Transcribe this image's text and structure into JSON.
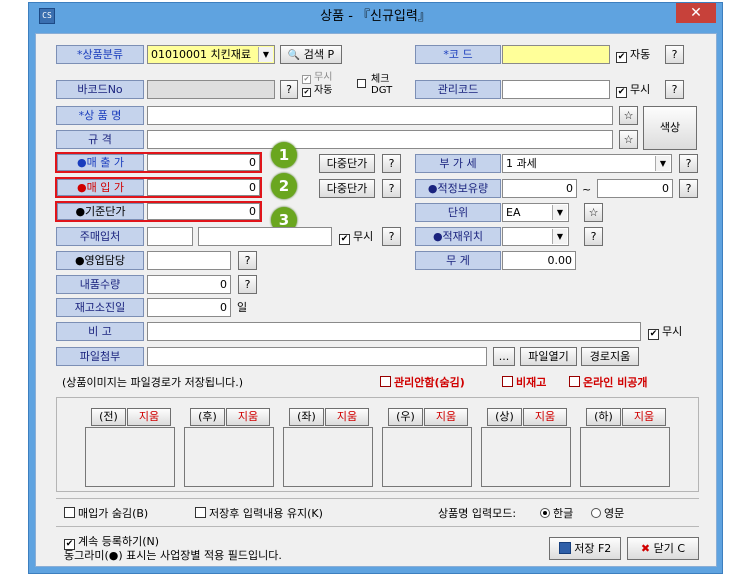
{
  "window": {
    "title": "상품 - 『신규입력』",
    "app_icon_text": "CS",
    "close": "✕"
  },
  "fields": {
    "product_category": {
      "label": "*상품분류",
      "value": "01010001 치킨재료",
      "search": "검색 P"
    },
    "code": {
      "label": "*코     드",
      "value": "",
      "auto_label": "자동",
      "help": "?"
    },
    "barcode": {
      "label": "바코드No",
      "value": "",
      "help": "?",
      "ignore": "무시",
      "auto": "자동",
      "check_dgt": "체크\nDGT"
    },
    "mgmt_code": {
      "label": "관리코드",
      "value": "",
      "ignore": "무시",
      "help": "?"
    },
    "product_name": {
      "label": "*상 품 명",
      "value": "",
      "star": "☆"
    },
    "spec": {
      "label": "규     격",
      "value": "",
      "star": "☆"
    },
    "color_size": "색상",
    "sale_price": {
      "label": "●매 출 가",
      "value": "0",
      "multi": "다중단가",
      "help": "?"
    },
    "purchase_price": {
      "label": "●매 입 가",
      "value": "0",
      "multi": "다중단가",
      "help": "?"
    },
    "base_price": {
      "label": "●기준단가",
      "value": "0"
    },
    "vat": {
      "label": "부 가 세",
      "value": "1 과세",
      "help": "?"
    },
    "safety_stock": {
      "label": "●적정보유량",
      "value_from": "0",
      "tilde": "~",
      "value_to": "0",
      "help": "?"
    },
    "unit": {
      "label": "단위",
      "value": "EA",
      "star": "☆"
    },
    "main_supplier": {
      "label": "주매입처",
      "ignore": "무시",
      "help": "?"
    },
    "location": {
      "label": "●적재위치",
      "value": "",
      "help": "?"
    },
    "sales_rep": {
      "label": "●영업담당",
      "value": "",
      "help": "?"
    },
    "weight": {
      "label": "무     게",
      "value": "0.00"
    },
    "delivery_qty": {
      "label": "내품수량",
      "value": "0",
      "help": "?"
    },
    "stock_days": {
      "label": "재고소진일",
      "value": "0",
      "unit": "일"
    },
    "remark": {
      "label": "비     고",
      "value": "",
      "ignore": "무시"
    },
    "attachment": {
      "label": "파일첨부",
      "value": "",
      "browse": "...",
      "open": "파일열기",
      "clear_path": "경로지움"
    }
  },
  "image_note": "(상품이미지는 파일경로가 저장됩니다.)",
  "flags": [
    "관리안함(숨김)",
    "비재고",
    "온라인 비공개"
  ],
  "image_panels": [
    {
      "label": "(전)",
      "delete": "지움"
    },
    {
      "label": "(후)",
      "delete": "지움"
    },
    {
      "label": "(좌)",
      "delete": "지움"
    },
    {
      "label": "(우)",
      "delete": "지움"
    },
    {
      "label": "(상)",
      "delete": "지움"
    },
    {
      "label": "(하)",
      "delete": "지움"
    }
  ],
  "options": {
    "hide_purchase": "매입가 숨김(B)",
    "keep_after_save": "저장후 입력내용 유지(K)",
    "name_input_mode": "상품명 입력모드:",
    "korean": "한글",
    "english": "영문",
    "continuous": "계속 등록하기(N)",
    "note": "동그라미(●) 표시는 사업장별 적용 필드입니다."
  },
  "actions": {
    "save": "저장 F2",
    "close": "닫기 C"
  },
  "badges": [
    "1",
    "2",
    "3"
  ],
  "colors": {
    "title_bar": "#5fa3e0",
    "label_bg": "#c5d3ec",
    "highlight": "#e0141a",
    "badge": "#6aa61f"
  }
}
